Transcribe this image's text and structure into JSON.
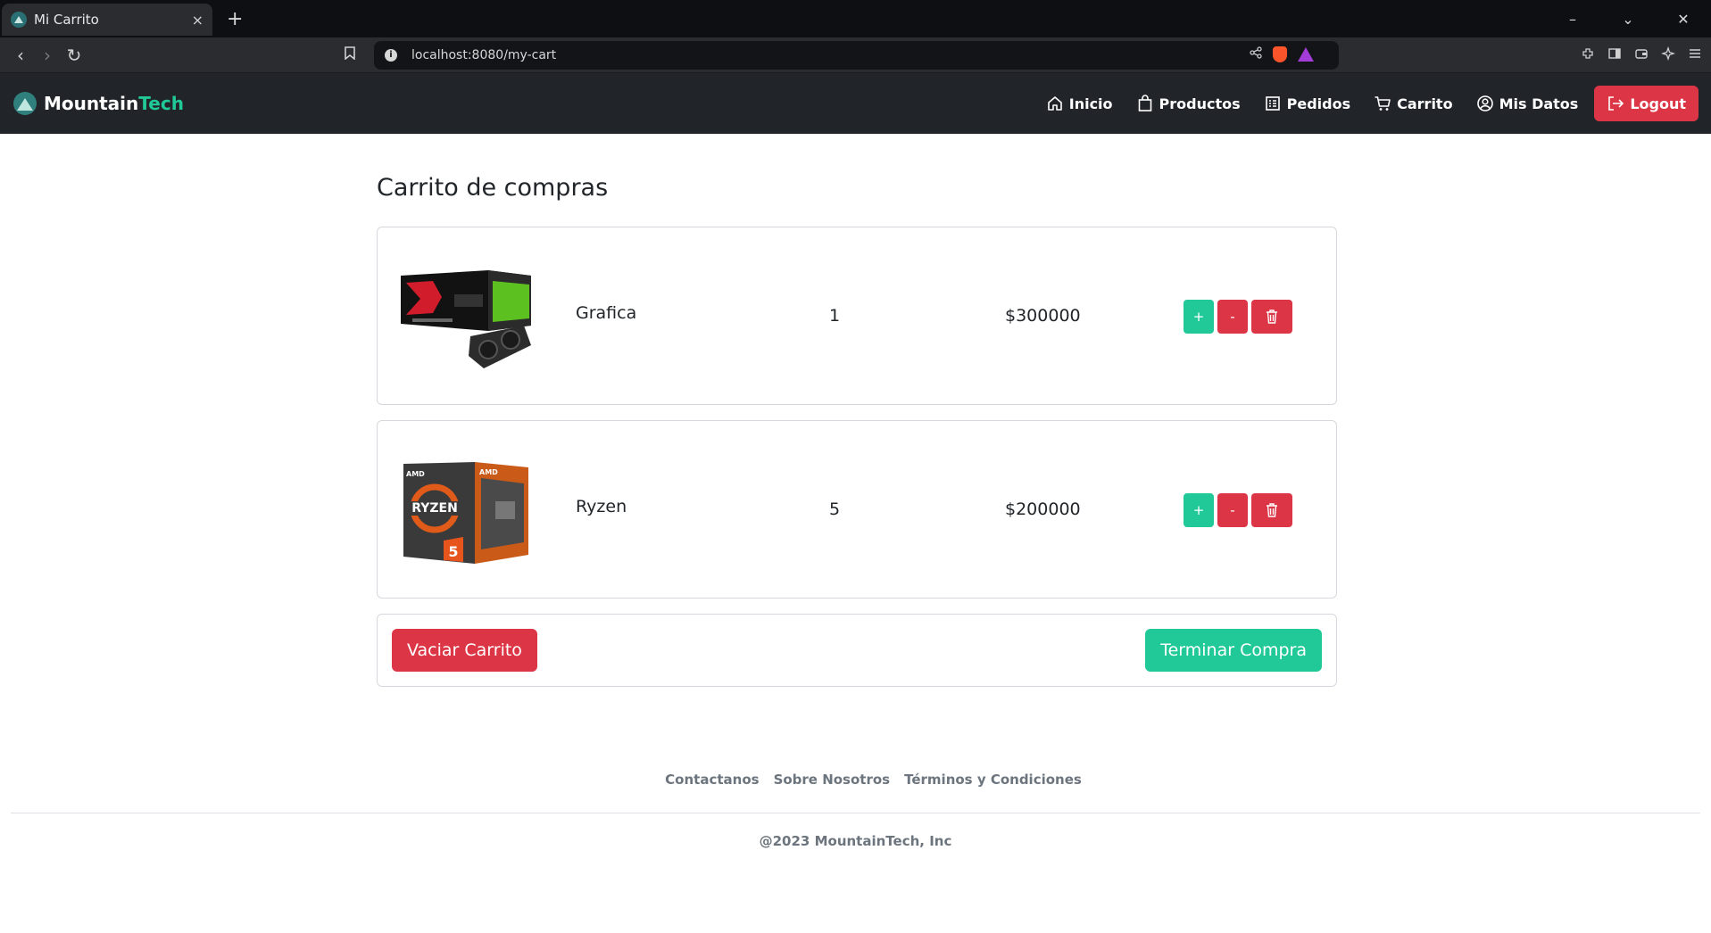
{
  "browser": {
    "tab_title": "Mi Carrito",
    "tab_close": "×",
    "new_tab": "+",
    "url": "localhost:8080/my-cart",
    "window_controls": [
      "–",
      "⌄",
      "✕"
    ]
  },
  "navbar": {
    "brand_main": "Mountain",
    "brand_accent": "Tech",
    "links": [
      {
        "label": "Inicio",
        "icon": "house-icon"
      },
      {
        "label": "Productos",
        "icon": "bag-icon"
      },
      {
        "label": "Pedidos",
        "icon": "list-icon"
      },
      {
        "label": "Carrito",
        "icon": "cart-icon"
      },
      {
        "label": "Mis Datos",
        "icon": "user-circle-icon"
      }
    ],
    "logout_label": "Logout"
  },
  "page": {
    "title": "Carrito de compras"
  },
  "cart": {
    "items": [
      {
        "name": "Grafica",
        "quantity": "1",
        "price": "$300000",
        "image": "graphics-card-box"
      },
      {
        "name": "Ryzen",
        "quantity": "5",
        "price": "$200000",
        "image": "ryzen-cpu-box"
      }
    ],
    "plus_label": "+",
    "minus_label": "-",
    "clear_label": "Vaciar Carrito",
    "checkout_label": "Terminar Compra"
  },
  "footer": {
    "links": [
      "Contactanos",
      "Sobre Nosotros",
      "Términos y Condiciones"
    ],
    "copyright": "@2023 MountainTech, Inc"
  },
  "colors": {
    "accent": "#20c997",
    "danger": "#dc3545",
    "navbar_bg": "#212529"
  }
}
